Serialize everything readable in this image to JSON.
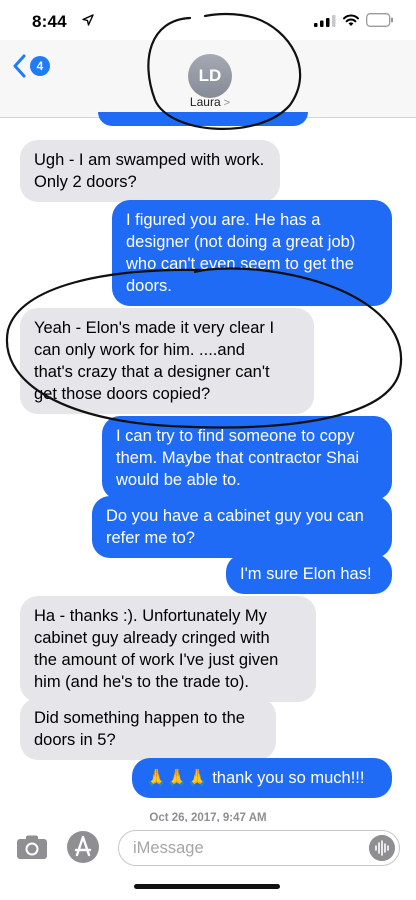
{
  "status_bar": {
    "time": "8:44"
  },
  "header": {
    "back_badge_count": "4",
    "avatar_initials": "LD",
    "contact_name": "Laura",
    "contact_chevron": ">"
  },
  "messages": [
    {
      "sender": "them",
      "text": "Ugh - I am swamped with work.\nOnly 2 doors?"
    },
    {
      "sender": "me",
      "text": "I figured you are. He has a\ndesigner (not doing a great job)\nwho can't even seem to get the\ndoors."
    },
    {
      "sender": "them",
      "text": "Yeah - Elon's made it very clear I\ncan only work for him.  ....and\nthat's crazy that a designer can't\nget those doors copied?"
    },
    {
      "sender": "me",
      "text": "I can try to find someone to copy\nthem. Maybe that contractor Shai\nwould be able to."
    },
    {
      "sender": "me",
      "text": "Do you have a cabinet guy you can\nrefer me to?"
    },
    {
      "sender": "me",
      "text": "I'm sure Elon has!"
    },
    {
      "sender": "them",
      "text": "Ha - thanks :). Unfortunately My\ncabinet guy already cringed with\nthe amount of work I've just given\nhim (and he's to the trade to)."
    },
    {
      "sender": "them",
      "text": "Did something happen to the\ndoors in 5?"
    },
    {
      "sender": "me",
      "text": "🙏🙏🙏 thank you so much!!!"
    }
  ],
  "timestamp": "Oct 26, 2017, 9:47 AM",
  "input_bar": {
    "placeholder": "iMessage"
  },
  "icons": {
    "camera": "camera-icon",
    "appstore": "app-store-icon",
    "audio": "audio-waveform-icon",
    "back": "chevron-left-icon"
  },
  "colors": {
    "sent_bubble": "#1f6bf5",
    "received_bubble": "#e5e5ea",
    "accent": "#1f7bf6",
    "annotation_ink": "#111111"
  }
}
